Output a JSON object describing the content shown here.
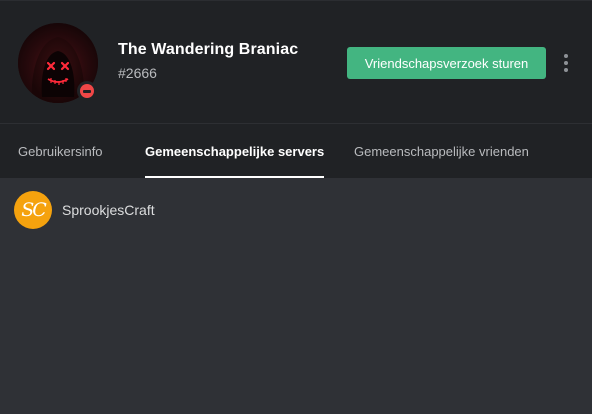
{
  "profile": {
    "username": "The Wandering Braniac",
    "discriminator": "#2666",
    "status": "dnd",
    "status_color": "#f04747"
  },
  "actions": {
    "friend_request_label": "Vriendschapsverzoek sturen",
    "friend_request_color": "#43b581",
    "more_icon": "vertical-ellipsis-icon"
  },
  "tabs": [
    {
      "label": "Gebruikersinfo",
      "active": false
    },
    {
      "label": "Gemeenschappelijke servers",
      "active": true
    },
    {
      "label": "Gemeenschappelijke vrienden",
      "active": false
    }
  ],
  "mutual_servers": [
    {
      "initials": "SC",
      "name": "SprookjesCraft",
      "icon_color": "#f5a20e"
    }
  ]
}
